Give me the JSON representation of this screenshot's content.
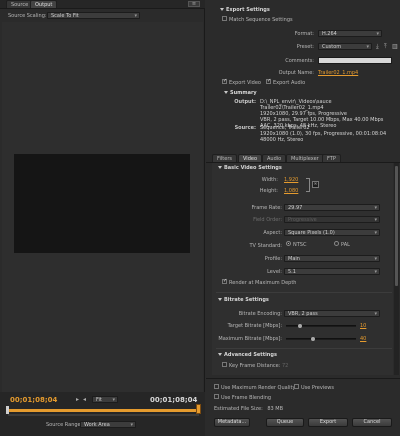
{
  "left": {
    "tabs": [
      "Source",
      "Output"
    ],
    "scaling_label": "Source Scaling:",
    "scaling_value": "Scale To Fit",
    "timecode_in": "00;01;08;04",
    "timecode_out": "00;01;08;04",
    "fit_value": "Fit",
    "source_range_label": "Source Range:",
    "source_range_value": "Work Area"
  },
  "export": {
    "header": "Export Settings",
    "match_label": "Match Sequence Settings",
    "format_label": "Format:",
    "format_value": "H.264",
    "preset_label": "Preset:",
    "preset_value": "Custom",
    "comments_label": "Comments:",
    "comments_value": "",
    "output_name_label": "Output Name:",
    "output_name_value": "Trailer02_1.mp4",
    "export_video_label": "Export Video",
    "export_audio_label": "Export Audio",
    "summary_header": "Summary",
    "output_label": "Output:",
    "output_lines": [
      "D:\\_NPL_envir\\_Videos\\sauce Trailer02\\Trailer02_1.mp4",
      "1920x1080, 29.97 fps, Progressive",
      "VBR, 2 pass, Target 10.00 Mbps, Max 40.00 Mbps",
      "AAC, 320 kbps, 48 kHz, Stereo"
    ],
    "source_label": "Source:",
    "source_lines": [
      "Sequence, Trailer02",
      "1920x1080 (1.0), 30 fps, Progressive, 00:01:08:04",
      "48000 Hz, Stereo"
    ]
  },
  "settings_tabs": [
    "Filters",
    "Video",
    "Audio",
    "Multiplexer",
    "FTP"
  ],
  "basic_video": {
    "header": "Basic Video Settings",
    "width_label": "Width:",
    "width_value": "1,920",
    "height_label": "Height:",
    "height_value": "1,080",
    "frame_rate_label": "Frame Rate:",
    "frame_rate_value": "29.97",
    "field_order_label": "Field Order:",
    "field_order_value": "Progressive",
    "aspect_label": "Aspect:",
    "aspect_value": "Square Pixels (1.0)",
    "tv_standard_label": "TV Standard:",
    "ntsc_label": "NTSC",
    "pal_label": "PAL",
    "profile_label": "Profile:",
    "profile_value": "Main",
    "level_label": "Level:",
    "level_value": "5.1",
    "render_max_label": "Render at Maximum Depth"
  },
  "bitrate": {
    "header": "Bitrate Settings",
    "encoding_label": "Bitrate Encoding:",
    "encoding_value": "VBR, 2 pass",
    "target_label": "Target Bitrate [Mbps]:",
    "target_value": "10",
    "target_fraction": 0.2,
    "max_label": "Maximum Bitrate [Mbps]:",
    "max_value": "40",
    "max_fraction": 0.38
  },
  "advanced": {
    "header": "Advanced Settings",
    "key_frame_label": "Key Frame Distance:",
    "key_frame_value": "72"
  },
  "footer": {
    "max_render_label": "Use Maximum Render Quality",
    "use_previews_label": "Use Previews",
    "frame_blending_label": "Use Frame Blending",
    "file_size_label": "Estimated File Size:",
    "file_size_value": "83 MB",
    "metadata_button": "Metadata...",
    "queue_button": "Queue",
    "export_button": "Export",
    "cancel_button": "Cancel"
  },
  "colors": {
    "accent": "#e59b2e",
    "panel_bg": "#2b2b2b",
    "dark_bg": "#232323"
  }
}
